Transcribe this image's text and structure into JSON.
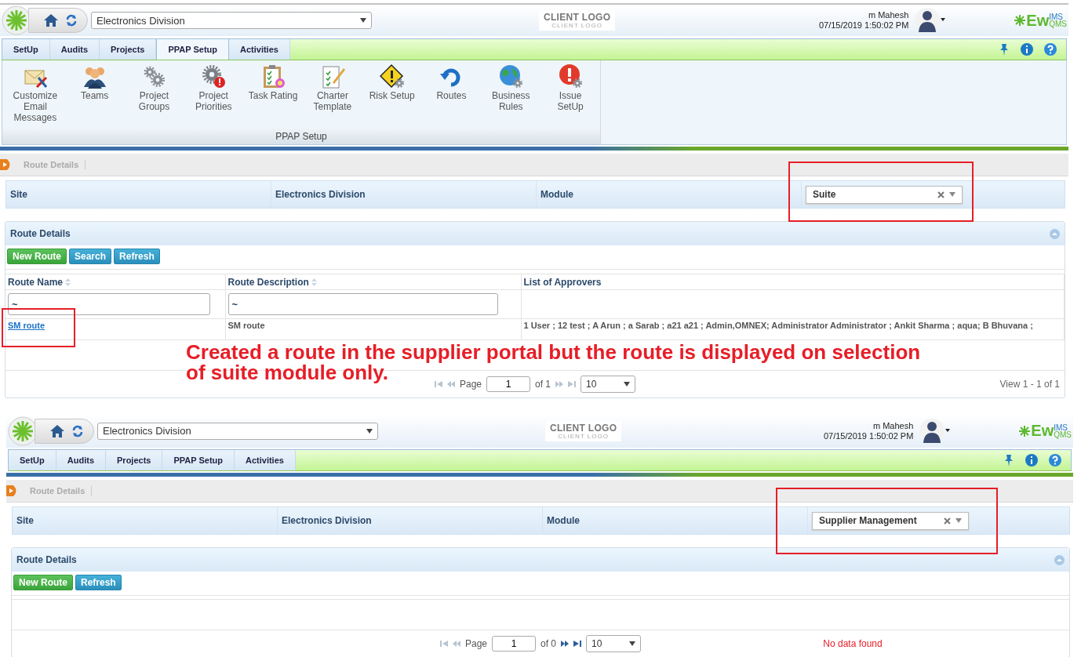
{
  "screens": [
    {
      "site_select": "Electronics Division",
      "client_logo": "CLIENT LOGO",
      "client_logo_sub": "CLIENT LOGO",
      "user": "m Mahesh",
      "datetime": "07/15/2019 1:50:02 PM",
      "brand": "Ew",
      "brand_sup": "IMS",
      "brand_sub": "QMS",
      "tabs": [
        {
          "label": "SetUp",
          "selected": false
        },
        {
          "label": "Audits",
          "selected": false
        },
        {
          "label": "Projects",
          "selected": false
        },
        {
          "label": "PPAP Setup",
          "selected": true
        },
        {
          "label": "Activities",
          "selected": false
        }
      ],
      "ribbon": {
        "group": "PPAP Setup",
        "items": [
          {
            "label": "Customize Email Messages"
          },
          {
            "label": "Teams"
          },
          {
            "label": "Project Groups"
          },
          {
            "label": "Project Priorities"
          },
          {
            "label": "Task Rating"
          },
          {
            "label": "Charter Template"
          },
          {
            "label": "Risk Setup"
          },
          {
            "label": "Routes"
          },
          {
            "label": "Business Rules"
          },
          {
            "label": "Issue SetUp"
          }
        ]
      },
      "breadcrumb": "Route Details",
      "filter": {
        "site_label": "Site",
        "site_value": "Electronics Division",
        "module_label": "Module",
        "module_value": "Suite",
        "module_highlighted": true
      },
      "panel": {
        "title": "Route Details",
        "buttons": [
          {
            "label": "New Route",
            "kind": "primary"
          },
          {
            "label": "Search",
            "kind": "info"
          },
          {
            "label": "Refresh",
            "kind": "info"
          }
        ],
        "table": {
          "columns": [
            {
              "label": "Route Name",
              "sortable": true,
              "filter": "~",
              "kind": "link"
            },
            {
              "label": "Route Description",
              "sortable": true,
              "filter": "~",
              "kind": "text"
            },
            {
              "label": "List of Approvers",
              "sortable": false,
              "kind": "text"
            }
          ],
          "rows": [
            {
              "highlighted": true,
              "cells": [
                "SM route",
                "SM route",
                "1 User ; 12 test ; A Arun ; a Sarab ; a21 a21 ; Admin,OMNEX; Administrator Administrator ; Ankit Sharma ; aqua; B Bhuvana ;"
              ]
            }
          ]
        },
        "note": "Created a route in the supplier portal but the route is displayed on selection of suite module only.",
        "pager": {
          "page_label": "Page",
          "page": "1",
          "of": "of 1",
          "page_size": "10",
          "next_disabled": true,
          "status": "View 1 - 1 of 1",
          "no_data": false
        }
      }
    },
    {
      "site_select": "Electronics Division",
      "client_logo": "CLIENT LOGO",
      "client_logo_sub": "CLIENT LOGO",
      "user": "m Mahesh",
      "datetime": "07/15/2019 1:50:02 PM",
      "brand": "Ew",
      "brand_sup": "IMS",
      "brand_sub": "QMS",
      "tabs": [
        {
          "label": "SetUp",
          "selected": false
        },
        {
          "label": "Audits",
          "selected": false
        },
        {
          "label": "Projects",
          "selected": false
        },
        {
          "label": "PPAP Setup",
          "selected": false
        },
        {
          "label": "Activities",
          "selected": false
        }
      ],
      "breadcrumb": "Route Details",
      "filter": {
        "site_label": "Site",
        "site_value": "Electronics Division",
        "module_label": "Module",
        "module_value": "Supplier Management",
        "module_highlighted": true
      },
      "panel": {
        "title": "Route Details",
        "buttons": [
          {
            "label": "New Route",
            "kind": "primary"
          },
          {
            "label": "Refresh",
            "kind": "info"
          }
        ],
        "pager": {
          "page_label": "Page",
          "page": "1",
          "of": "of 0",
          "page_size": "10",
          "next_disabled": false,
          "status": "No data found",
          "no_data": true
        }
      }
    }
  ]
}
